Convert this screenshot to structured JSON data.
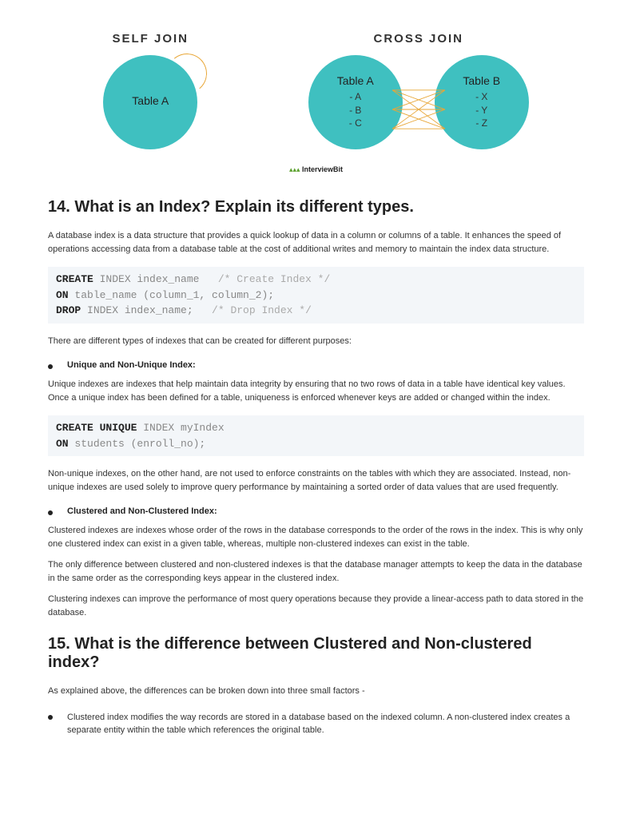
{
  "diagram": {
    "self_title": "SELF JOIN",
    "cross_title": "CROSS JOIN",
    "self_label": "Table A",
    "crossA_label": "Table A",
    "crossA_items": "- A\n- B\n- C",
    "crossB_label": "Table B",
    "crossB_items": "- X\n- Y\n- Z",
    "attribution": "InterviewBit"
  },
  "q14": {
    "heading": "14. What is an Index? Explain its different types.",
    "intro": "A database index is a data structure that provides a quick lookup of data in a column or columns of a table. It enhances the speed of operations accessing data from a database table at the cost of additional writes and memory to maintain the index data structure.",
    "after_code": "There are different types of indexes that can be created for different purposes:",
    "b1_title": "Unique and Non-Unique Index:",
    "b1_p1": "Unique indexes are indexes that help maintain data integrity by ensuring that no two rows of data in a table have identical key values. Once a unique index has been defined for a table, uniqueness is enforced whenever keys are added or changed within the index.",
    "b1_p2": "Non-unique indexes, on the other hand, are not used to enforce constraints on the tables with which they are associated. Instead, non-unique indexes are used solely to improve query performance by maintaining a sorted order of data values that are used frequently.",
    "b2_title": "Clustered and Non-Clustered Index:",
    "b2_p1": "Clustered indexes are indexes whose order of the rows in the database corresponds to the order of the rows in the index. This is why only one clustered index can exist in a given table, whereas, multiple non-clustered indexes can exist in the table.",
    "b2_p2": "The only difference between clustered and non-clustered indexes is that the database manager attempts to keep the data in the database in the same order as the corresponding keys appear in the clustered index.",
    "b2_p3": "Clustering indexes can improve the performance of most query operations because they provide a linear-access path to data stored in the database."
  },
  "q15": {
    "heading": "15. What is the difference between Clustered and Non-clustered index?",
    "intro": "As explained above, the differences can be broken down into three small factors -",
    "b1": "Clustered index modifies the way records are stored in a database based on the indexed column. A non-clustered index creates a separate entity within the table which references the original table."
  }
}
